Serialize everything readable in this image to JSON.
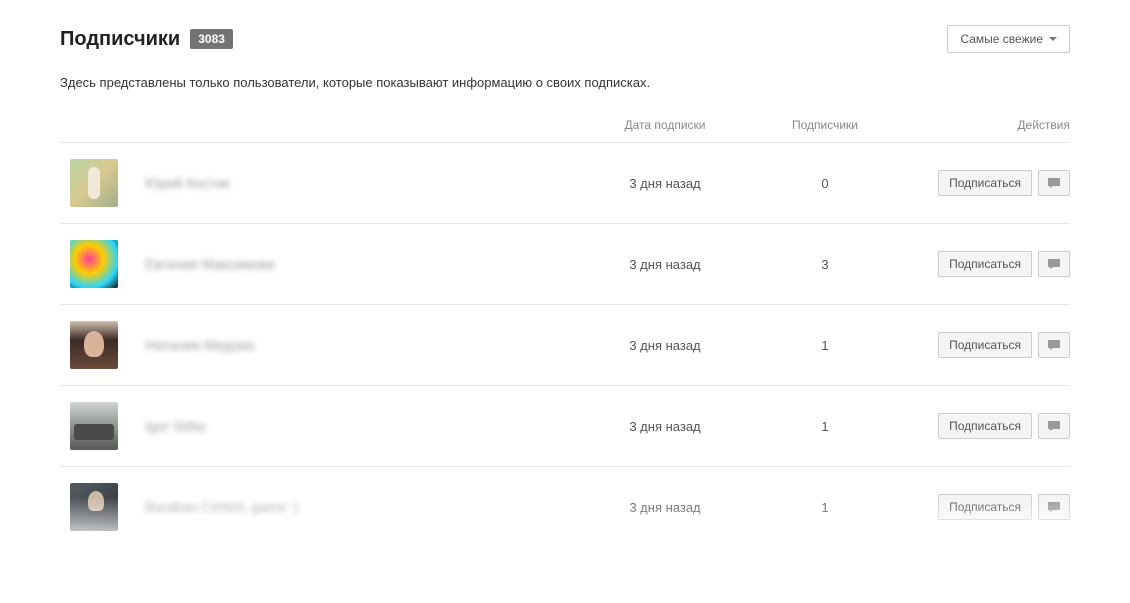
{
  "header": {
    "title": "Подписчики",
    "count": "3083",
    "sort_label": "Самые свежие"
  },
  "description": "Здесь представлены только пользователи, которые показывают информацию о своих подписках.",
  "columns": {
    "date": "Дата подписки",
    "subscribers": "Подписчики",
    "actions": "Действия"
  },
  "actions": {
    "subscribe_label": "Подписаться"
  },
  "rows": [
    {
      "name": "Юрий Костик",
      "date": "3 дня назад",
      "subscribers": "0",
      "avatar_class": "av1"
    },
    {
      "name": "Евгения Максимова",
      "date": "3 дня назад",
      "subscribers": "3",
      "avatar_class": "av2"
    },
    {
      "name": "Наталия Медова",
      "date": "3 дня назад",
      "subscribers": "1",
      "avatar_class": "av3"
    },
    {
      "name": "Igor Sirbu",
      "date": "3 дня назад",
      "subscribers": "1",
      "avatar_class": "av4"
    },
    {
      "name": "Barabas CANAL game :)",
      "date": "3 дня назад",
      "subscribers": "1",
      "avatar_class": "av5"
    }
  ]
}
